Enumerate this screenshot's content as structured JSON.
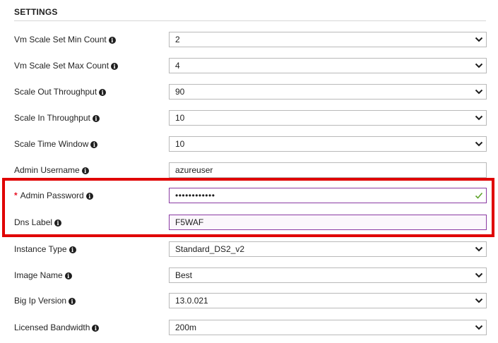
{
  "section": {
    "title": "SETTINGS"
  },
  "fields": [
    {
      "label": "Vm Scale Set Min Count",
      "value": "2",
      "type": "dropdown",
      "required": false
    },
    {
      "label": "Vm Scale Set Max Count",
      "value": "4",
      "type": "dropdown",
      "required": false
    },
    {
      "label": "Scale Out Throughput",
      "value": "90",
      "type": "dropdown",
      "required": false
    },
    {
      "label": "Scale In Throughput",
      "value": "10",
      "type": "dropdown",
      "required": false
    },
    {
      "label": "Scale Time Window",
      "value": "10",
      "type": "dropdown",
      "required": false
    },
    {
      "label": "Admin Username",
      "value": "azureuser",
      "type": "text",
      "required": false
    },
    {
      "label": "Admin Password",
      "value": "••••••••••••",
      "type": "password",
      "required": true,
      "required_mark": "*",
      "valid": true
    },
    {
      "label": "Dns Label",
      "value": "F5WAF",
      "type": "text",
      "required": false
    },
    {
      "label": "Instance Type",
      "value": "Standard_DS2_v2",
      "type": "dropdown",
      "required": false
    },
    {
      "label": "Image Name",
      "value": "Best",
      "type": "dropdown",
      "required": false
    },
    {
      "label": "Big Ip Version",
      "value": "13.0.021",
      "type": "dropdown",
      "required": false
    },
    {
      "label": "Licensed Bandwidth",
      "value": "200m",
      "type": "dropdown",
      "required": false
    }
  ],
  "icons": {
    "info": "info-icon",
    "dropdown": "chevron-down-icon",
    "valid": "checkmark-icon"
  },
  "colors": {
    "highlight": "#e00000",
    "focus_border": "#8a3aa3",
    "valid_check": "#5fa32b",
    "required_star": "#e81123"
  }
}
